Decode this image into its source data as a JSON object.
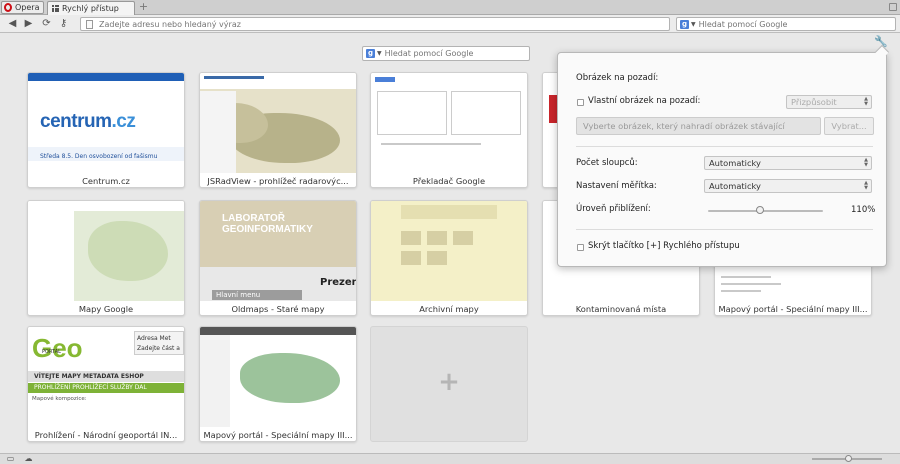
{
  "tabbar": {
    "opera_label": "Opera",
    "tab_label": "Rychlý přístup",
    "new_tab": "+"
  },
  "toolbar": {
    "back": "◀",
    "forward": "▶",
    "reload": "⟳",
    "key": "⚷",
    "address_placeholder": "Zadejte adresu nebo hledaný výraz",
    "search_placeholder": "Hledat pomocí Google",
    "search_engine_icon": "g-icon"
  },
  "speeddial": {
    "search_placeholder": "Hledat pomocí Google",
    "settings_icon": "wrench-icon",
    "add_tile": "+",
    "tiles": [
      {
        "label": "Centrum.cz",
        "thumb_text": "centrum",
        "thumb_text2": ".cz",
        "news": "Středa 8.5.   Den osvobození od fašismu"
      },
      {
        "label": "JSRadView - prohlížeč radarovýc..."
      },
      {
        "label": "Překladač Google"
      },
      {
        "label": "Mapy Google"
      },
      {
        "label": "Oldmaps - Staré mapy",
        "lab1": "LABORATOŘ",
        "lab2": "GEOINFORMATIKY",
        "present": "Prezenta",
        "menu": "Hlavní menu"
      },
      {
        "label": "Archivní mapy"
      },
      {
        "label": "Kontaminovaná místa"
      },
      {
        "label": "Mapový portál - Speciální mapy III..."
      },
      {
        "label": "Prohlížení - Národní geoportál IN...",
        "brand": "Geo",
        "portal": "PORTAL",
        "nav1": "VÍTEJTE   MAPY   METADATA   ESHOP",
        "nav2": "PROHLÍŽENÍ   PROHLÍŽECÍ SLUŽBY   DAL",
        "komp": "Mapové kompozice:",
        "adresa": "Adresa  Met",
        "adresa2": "Zadejte část a"
      },
      {
        "label": "Mapový portál - Speciální mapy III..."
      }
    ]
  },
  "settings": {
    "background_title": "Obrázek na pozadí:",
    "custom_bg_label": "Vlastní obrázek na pozadí:",
    "fit_select": "Přizpůsobit",
    "choose_placeholder": "Vyberte obrázek, který nahradí obrázek stávající",
    "choose_button": "Vybrat...",
    "columns_label": "Počet sloupců:",
    "columns_value": "Automaticky",
    "scale_label": "Nastavení měřítka:",
    "scale_value": "Automaticky",
    "zoom_label": "Úroveň přiblížení:",
    "zoom_value": "110%",
    "zoom_level": 0.45,
    "hide_button_label": "Skrýt tlačítko [+] Rychlého přístupu"
  },
  "statusbar": {
    "left_icon1": "panel-icon",
    "left_icon2": "cloud-icon"
  }
}
